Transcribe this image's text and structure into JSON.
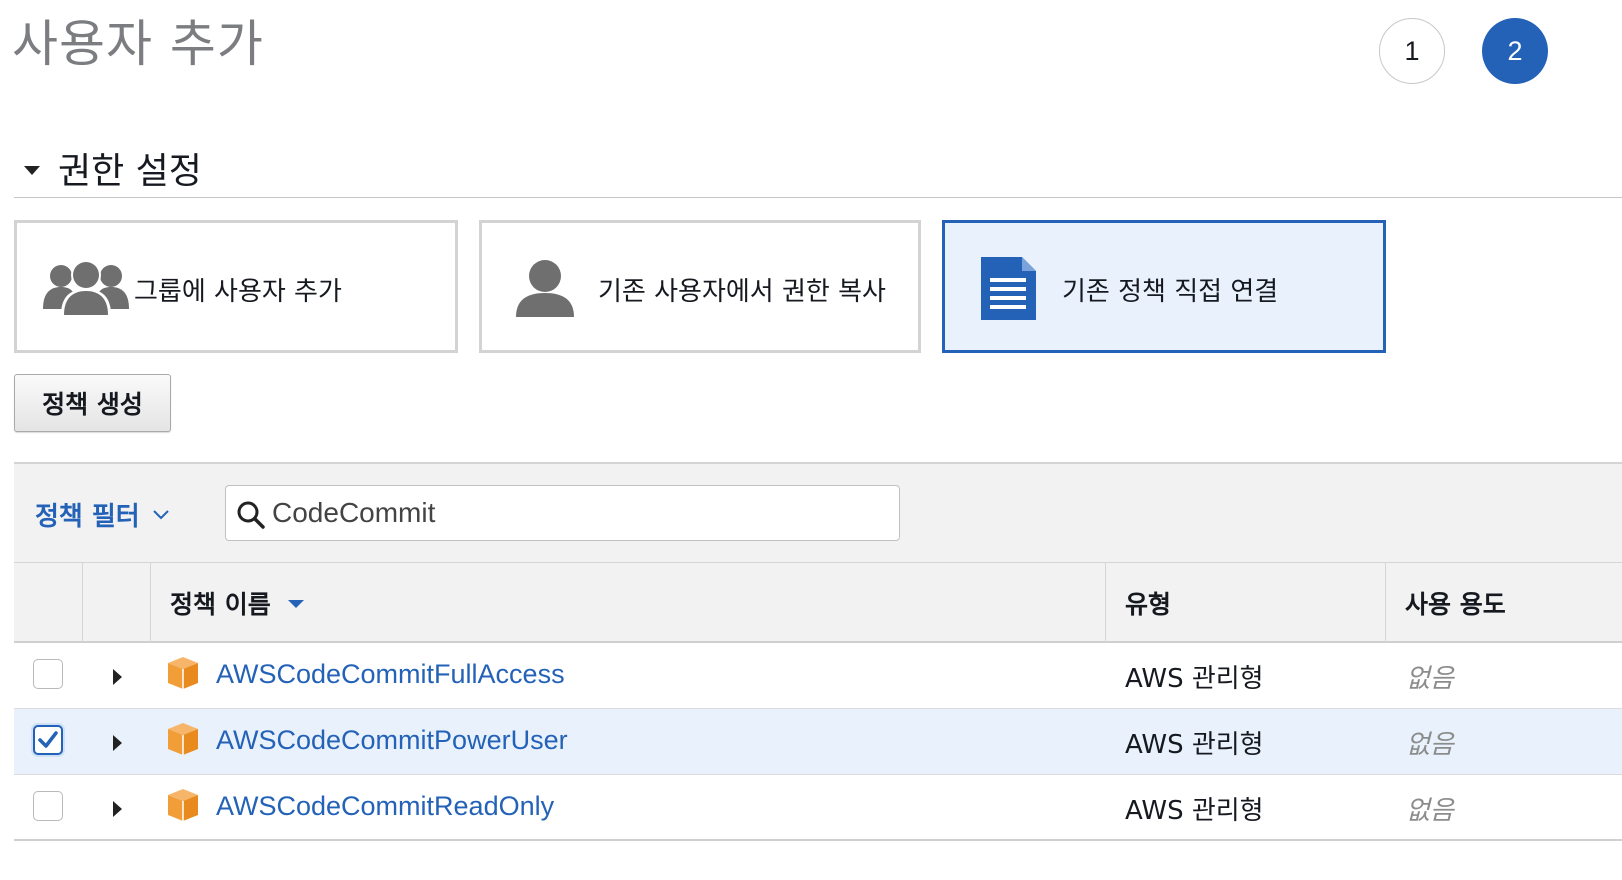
{
  "page": {
    "title": "사용자 추가"
  },
  "steps": [
    "1",
    "2"
  ],
  "section": {
    "title": "권한 설정"
  },
  "options": [
    {
      "label": "그룹에 사용자 추가",
      "icon": "users-group-icon"
    },
    {
      "label": "기존 사용자에서 권한 복사",
      "icon": "user-icon"
    },
    {
      "label": "기존 정책 직접 연결",
      "icon": "document-icon",
      "selected": true
    }
  ],
  "create_policy_button": "정책 생성",
  "filter": {
    "label": "정책 필터",
    "search_value": "CodeCommit"
  },
  "table": {
    "headers": {
      "name": "정책 이름",
      "type": "유형",
      "usage": "사용 용도"
    },
    "rows": [
      {
        "name": "AWSCodeCommitFullAccess",
        "type": "AWS 관리형",
        "usage": "없음",
        "checked": false
      },
      {
        "name": "AWSCodeCommitPowerUser",
        "type": "AWS 관리형",
        "usage": "없음",
        "checked": true
      },
      {
        "name": "AWSCodeCommitReadOnly",
        "type": "AWS 관리형",
        "usage": "없음",
        "checked": false
      }
    ]
  },
  "colors": {
    "accent": "#2462b8",
    "selected_bg": "#e9f2fc",
    "icon_orange": "#f19e39"
  }
}
